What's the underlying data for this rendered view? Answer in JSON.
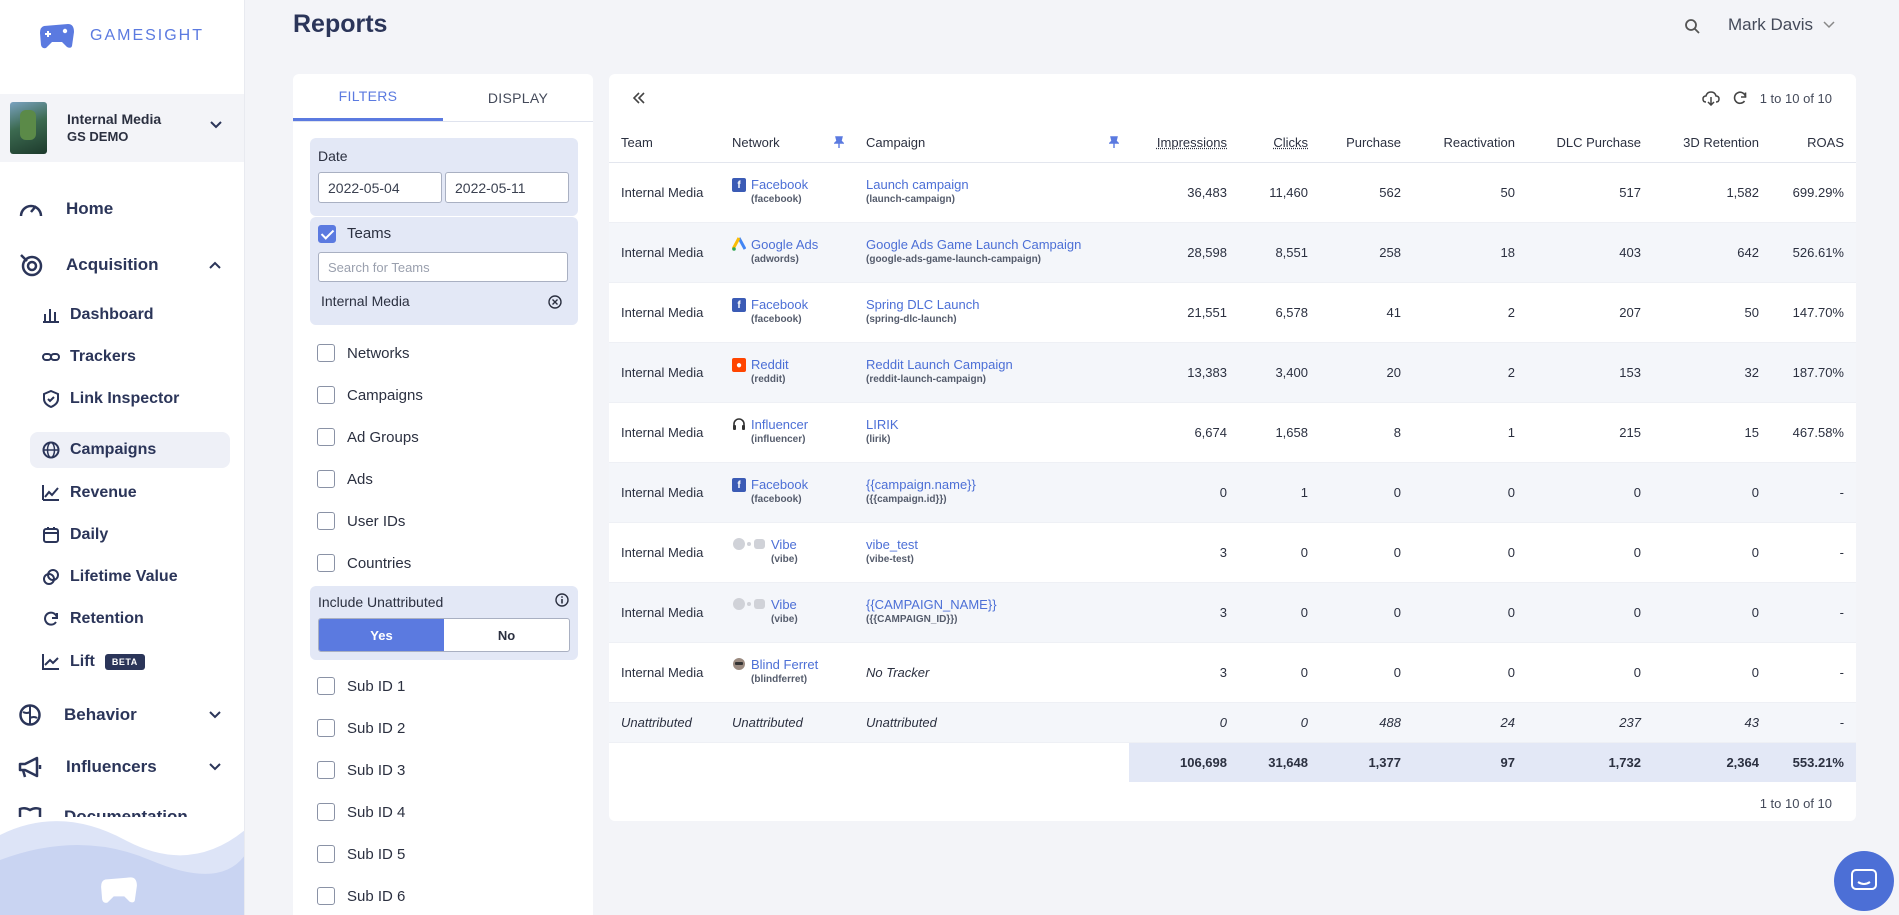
{
  "brand": {
    "name": "GAMESIGHT",
    "accent": "#5b7ae0"
  },
  "org": {
    "name": "Internal Media",
    "sub": "GS DEMO"
  },
  "nav": {
    "home": "Home",
    "acquisition": "Acquisition",
    "acquisition_items": [
      "Dashboard",
      "Trackers",
      "Link Inspector",
      "Campaigns",
      "Revenue",
      "Daily",
      "Lifetime Value",
      "Retention",
      "Lift"
    ],
    "lift_badge": "BETA",
    "behavior": "Behavior",
    "influencers": "Influencers",
    "documentation": "Documentation"
  },
  "header": {
    "title": "Reports",
    "user": "Mark Davis"
  },
  "filters": {
    "tabs": [
      "FILTERS",
      "DISPLAY"
    ],
    "date_label": "Date",
    "date_from": "2022-05-04",
    "date_to": "2022-05-11",
    "teams_label": "Teams",
    "teams_placeholder": "Search for Teams",
    "teams_selected": "Internal Media",
    "checkboxes": [
      "Networks",
      "Campaigns",
      "Ad Groups",
      "Ads",
      "User IDs",
      "Countries"
    ],
    "unattributed_label": "Include Unattributed",
    "yes": "Yes",
    "no": "No",
    "sub_ids": [
      "Sub ID 1",
      "Sub ID 2",
      "Sub ID 3",
      "Sub ID 4",
      "Sub ID 5",
      "Sub ID 6"
    ]
  },
  "table": {
    "page_info": "1 to 10 of 10",
    "headers": [
      "Team",
      "Network",
      "Campaign",
      "Impressions",
      "Clicks",
      "Purchase",
      "Reactivation",
      "DLC Purchase",
      "3D Retention",
      "ROAS"
    ],
    "rows": [
      {
        "team": "Internal Media",
        "network": "Facebook",
        "network_id": "(facebook)",
        "net_icon": "facebook-icon",
        "campaign": "Launch campaign",
        "campaign_id": "(launch-campaign)",
        "impressions": "36,483",
        "clicks": "11,460",
        "purchase": "562",
        "reactivation": "50",
        "dlc": "517",
        "retention": "1,582",
        "roas": "699.29%"
      },
      {
        "team": "Internal Media",
        "network": "Google Ads",
        "network_id": "(adwords)",
        "net_icon": "google-ads-icon",
        "campaign": "Google Ads Game Launch Campaign",
        "campaign_id": "(google-ads-game-launch-campaign)",
        "impressions": "28,598",
        "clicks": "8,551",
        "purchase": "258",
        "reactivation": "18",
        "dlc": "403",
        "retention": "642",
        "roas": "526.61%"
      },
      {
        "team": "Internal Media",
        "network": "Facebook",
        "network_id": "(facebook)",
        "net_icon": "facebook-icon",
        "campaign": "Spring DLC Launch",
        "campaign_id": "(spring-dlc-launch)",
        "impressions": "21,551",
        "clicks": "6,578",
        "purchase": "41",
        "reactivation": "2",
        "dlc": "207",
        "retention": "50",
        "roas": "147.70%"
      },
      {
        "team": "Internal Media",
        "network": "Reddit",
        "network_id": "(reddit)",
        "net_icon": "reddit-icon",
        "campaign": "Reddit Launch Campaign",
        "campaign_id": "(reddit-launch-campaign)",
        "impressions": "13,383",
        "clicks": "3,400",
        "purchase": "20",
        "reactivation": "2",
        "dlc": "153",
        "retention": "32",
        "roas": "187.70%"
      },
      {
        "team": "Internal Media",
        "network": "Influencer",
        "network_id": "(influencer)",
        "net_icon": "influencer-icon",
        "campaign": "LIRIK",
        "campaign_id": "(lirik)",
        "impressions": "6,674",
        "clicks": "1,658",
        "purchase": "8",
        "reactivation": "1",
        "dlc": "215",
        "retention": "15",
        "roas": "467.58%"
      },
      {
        "team": "Internal Media",
        "network": "Facebook",
        "network_id": "(facebook)",
        "net_icon": "facebook-icon",
        "campaign": "{{campaign.name}}",
        "campaign_id": "({{campaign.id}})",
        "impressions": "0",
        "clicks": "1",
        "purchase": "0",
        "reactivation": "0",
        "dlc": "0",
        "retention": "0",
        "roas": "-"
      },
      {
        "team": "Internal Media",
        "network": "Vibe",
        "network_id": "(vibe)",
        "net_icon": "vibe-icon",
        "campaign": "vibe_test",
        "campaign_id": "(vibe-test)",
        "impressions": "3",
        "clicks": "0",
        "purchase": "0",
        "reactivation": "0",
        "dlc": "0",
        "retention": "0",
        "roas": "-"
      },
      {
        "team": "Internal Media",
        "network": "Vibe",
        "network_id": "(vibe)",
        "net_icon": "vibe-icon",
        "campaign": "{{CAMPAIGN_NAME}}",
        "campaign_id": "({{CAMPAIGN_ID}})",
        "impressions": "3",
        "clicks": "0",
        "purchase": "0",
        "reactivation": "0",
        "dlc": "0",
        "retention": "0",
        "roas": "-"
      },
      {
        "team": "Internal Media",
        "network": "Blind Ferret",
        "network_id": "(blindferret)",
        "net_icon": "blind-ferret-icon",
        "campaign": "No Tracker",
        "campaign_id": "",
        "impressions": "3",
        "clicks": "0",
        "purchase": "0",
        "reactivation": "0",
        "dlc": "0",
        "retention": "0",
        "roas": "-"
      }
    ],
    "unattributed": {
      "team": "Unattributed",
      "network": "Unattributed",
      "campaign": "Unattributed",
      "impressions": "0",
      "clicks": "0",
      "purchase": "488",
      "reactivation": "24",
      "dlc": "237",
      "retention": "43",
      "roas": "-"
    },
    "totals": {
      "impressions": "106,698",
      "clicks": "31,648",
      "purchase": "1,377",
      "reactivation": "97",
      "dlc": "1,732",
      "retention": "2,364",
      "roas": "553.21%"
    }
  }
}
